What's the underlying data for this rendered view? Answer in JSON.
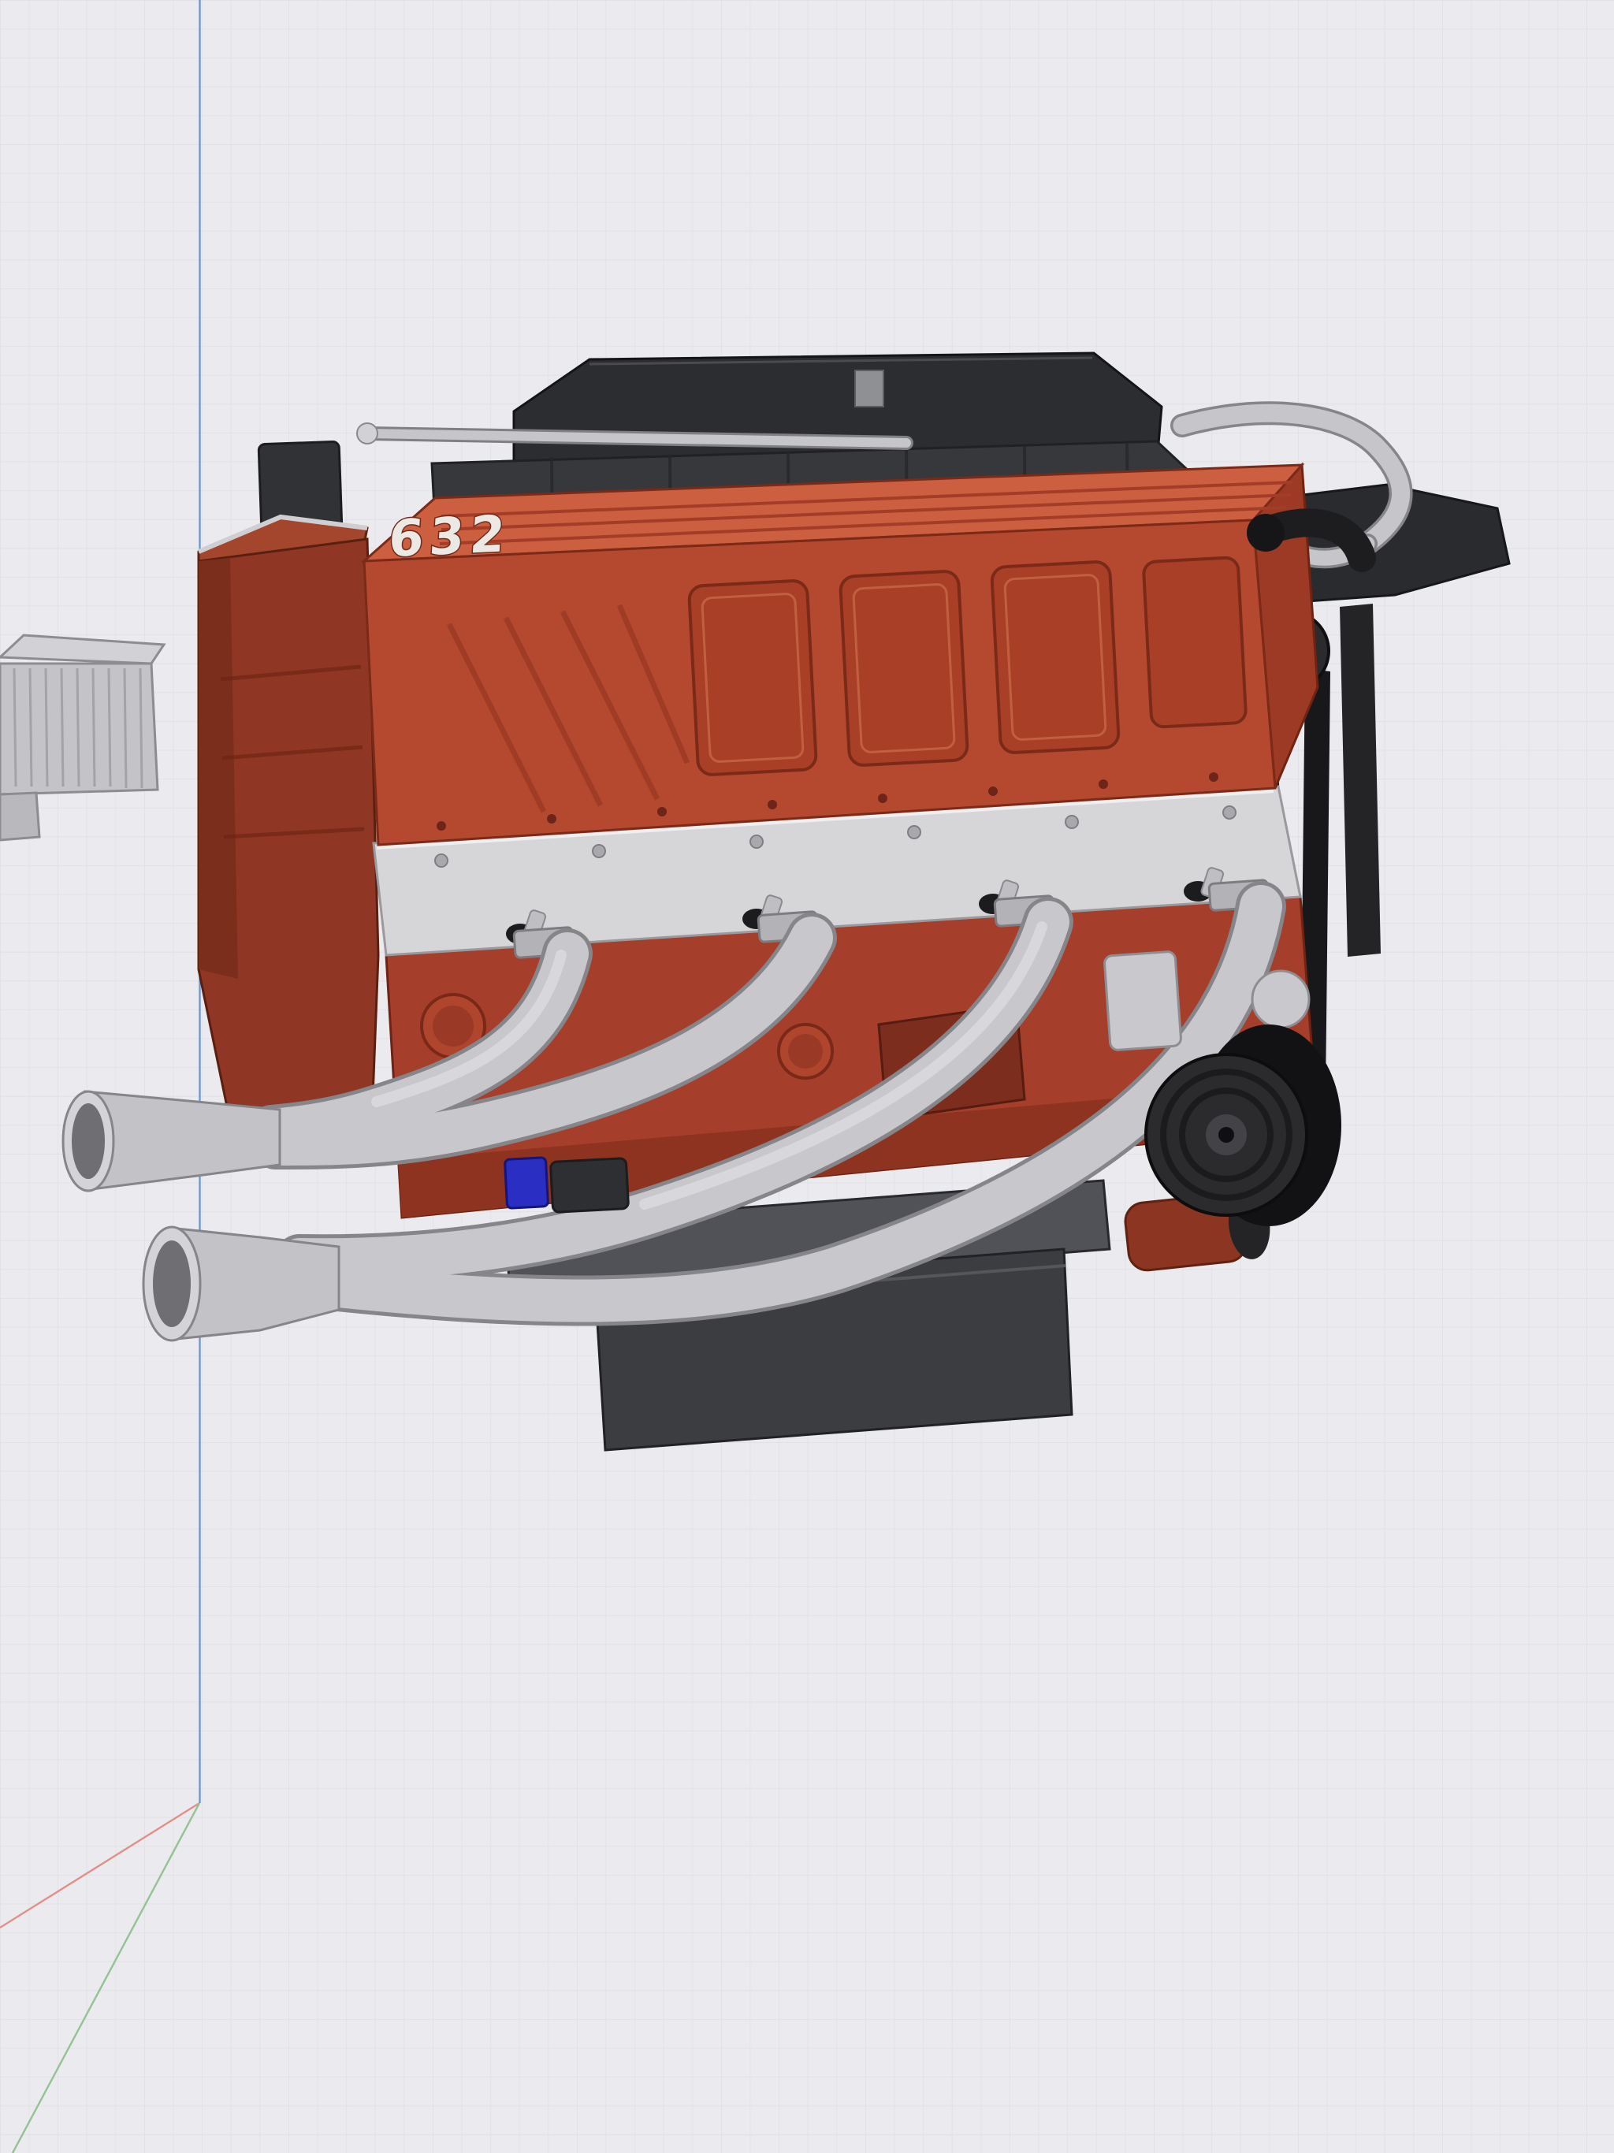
{
  "scene": {
    "type": "3d-cad-viewport",
    "background": "#ebebef",
    "grid_line_color": "#dfdfe3",
    "grid_size_px": 36.6
  },
  "axes": {
    "z_color": "#6f98cf",
    "x_color": "#e19089",
    "y_color": "#95c295"
  },
  "model": {
    "name": "v8-big-block-engine",
    "valve_cover_label": "632",
    "parts": {
      "air_box": "#2c2d30",
      "intake": "#37383c",
      "rear_mass": "#2a2b2e",
      "silver_pipe": "#c6c6ca",
      "valve_cover_front": "#b5492f",
      "valve_cover_top": "#cd5f41",
      "valve_cover_end": "#9c3a26",
      "timing_cover": "#8f3724",
      "timing_gable": "#a3462d",
      "head": "#d6d6d8",
      "block": "#a53e2a",
      "block_lower": "#8d3320",
      "mount_bracket": "#7c2d1d",
      "oil_pan": "#3c3d41",
      "pan_rail": "#515257",
      "header_tube": "#c8c8cc",
      "header_outline": "#85858a",
      "flare": "#c3c3c7",
      "flare_mouth": "#d4d4d8",
      "belt": "#18181a",
      "pulley": "#2b2b2e",
      "starter": "#8d3523",
      "blue_fitting": "#2a2ec2",
      "side_unit": "#c4c4c8"
    }
  }
}
